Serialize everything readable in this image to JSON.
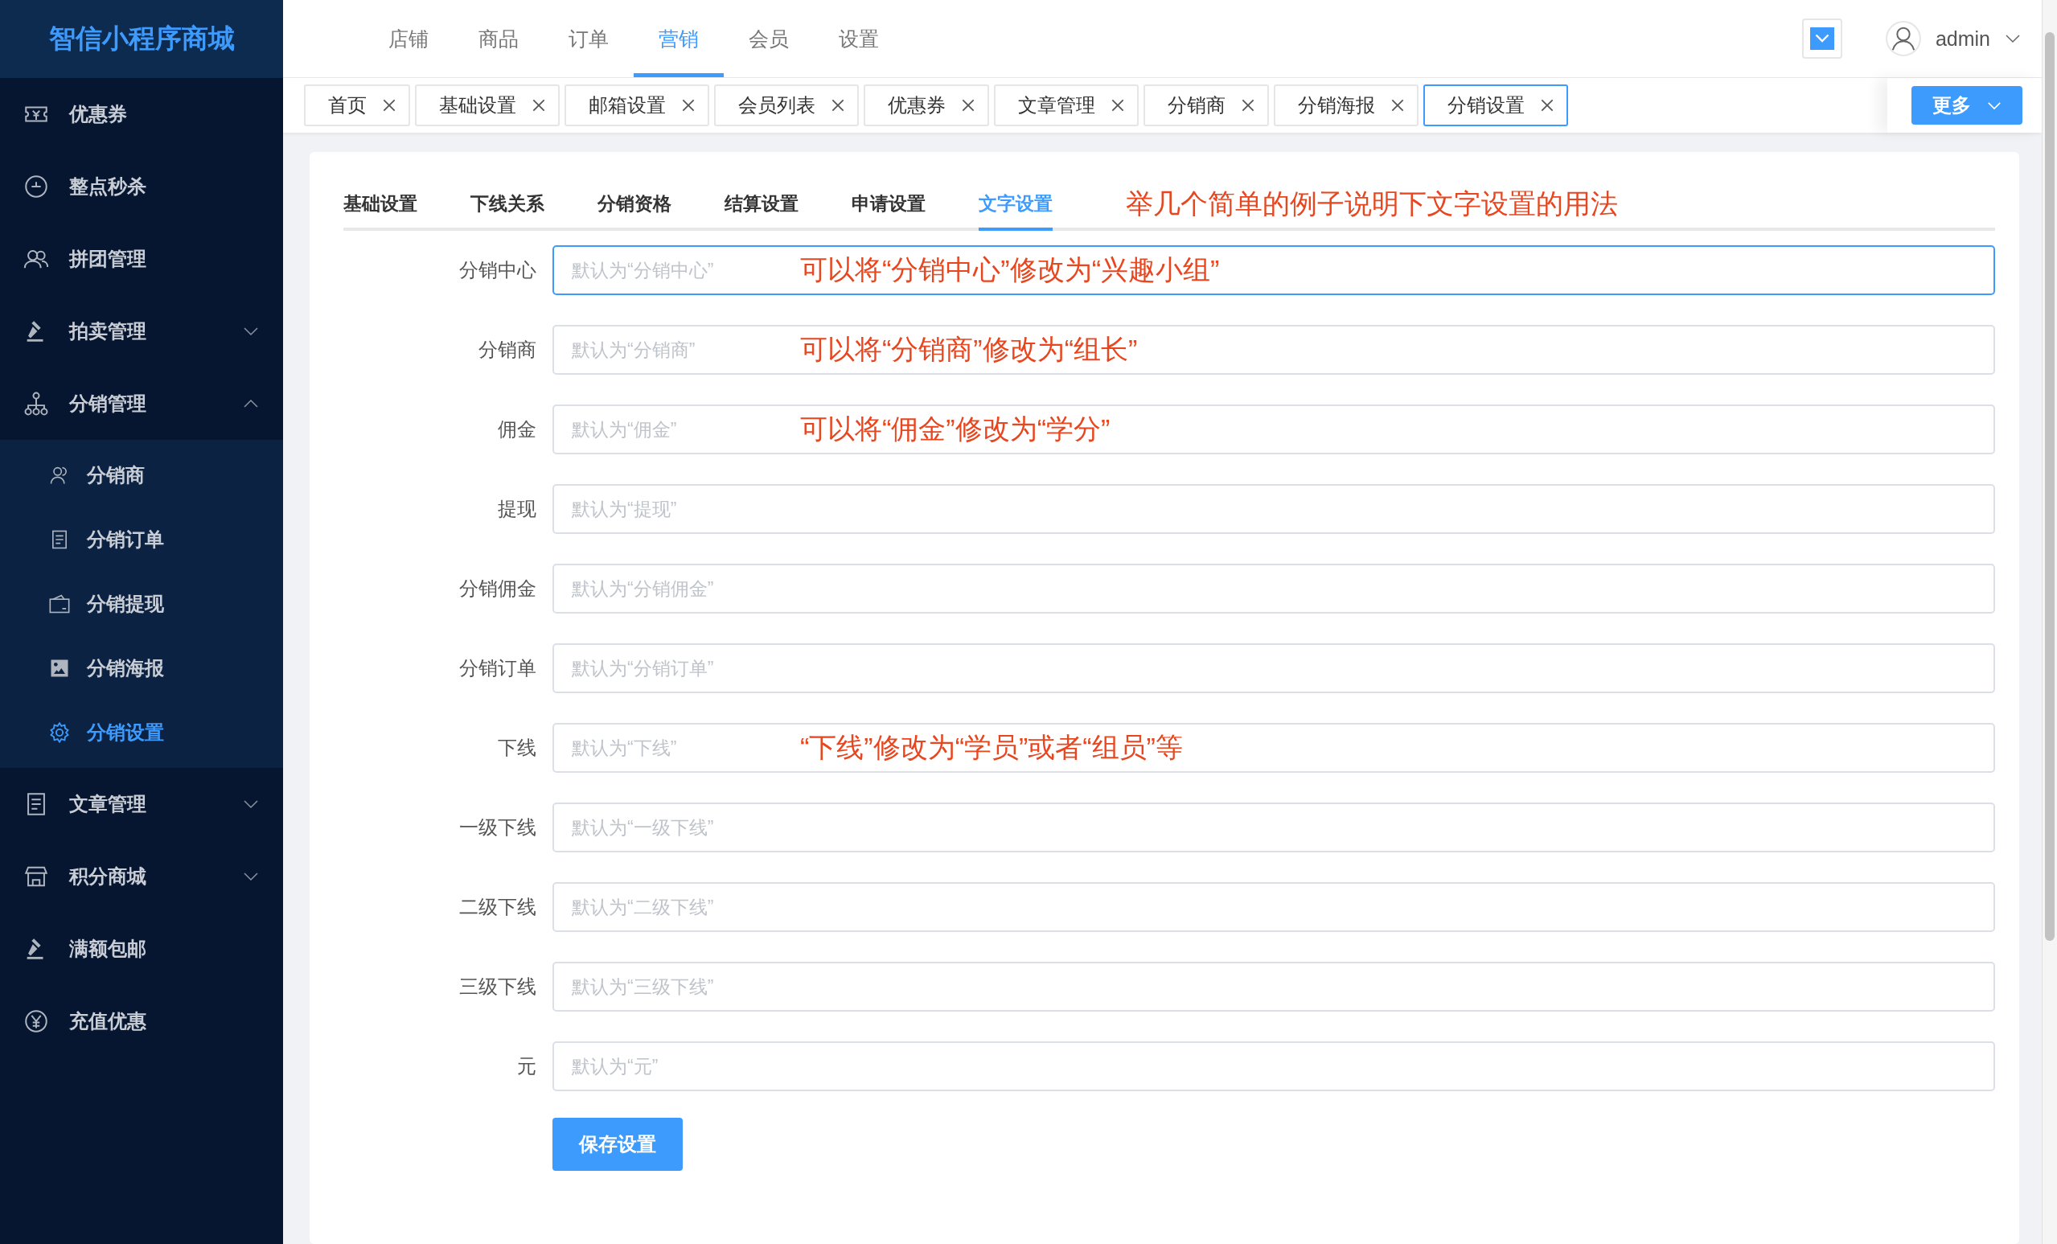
{
  "sidebar": {
    "logo": "智信小程序商城",
    "items": [
      {
        "label": "优惠券"
      },
      {
        "label": "整点秒杀"
      },
      {
        "label": "拼团管理"
      },
      {
        "label": "拍卖管理",
        "expanded": false
      },
      {
        "label": "分销管理",
        "expanded": true,
        "children": [
          {
            "label": "分销商",
            "selected": false
          },
          {
            "label": "分销订单",
            "selected": false
          },
          {
            "label": "分销提现",
            "selected": false
          },
          {
            "label": "分销海报",
            "selected": false
          },
          {
            "label": "分销设置",
            "selected": true
          }
        ]
      },
      {
        "label": "文章管理",
        "expanded": false
      },
      {
        "label": "积分商城",
        "expanded": false
      },
      {
        "label": "满额包邮"
      },
      {
        "label": "充值优惠"
      }
    ]
  },
  "top_nav": [
    {
      "label": "店铺",
      "selected": false
    },
    {
      "label": "商品",
      "selected": false
    },
    {
      "label": "订单",
      "selected": false
    },
    {
      "label": "营销",
      "selected": true
    },
    {
      "label": "会员",
      "selected": false
    },
    {
      "label": "设置",
      "selected": false
    }
  ],
  "user": {
    "name": "admin"
  },
  "open_tabs": [
    {
      "label": "首页",
      "selected": false
    },
    {
      "label": "基础设置",
      "selected": false
    },
    {
      "label": "邮箱设置",
      "selected": false
    },
    {
      "label": "会员列表",
      "selected": false
    },
    {
      "label": "优惠券",
      "selected": false
    },
    {
      "label": "文章管理",
      "selected": false
    },
    {
      "label": "分销商",
      "selected": false
    },
    {
      "label": "分销海报",
      "selected": false
    },
    {
      "label": "分销设置",
      "selected": true
    }
  ],
  "more_button": "更多",
  "settings_tabs": [
    {
      "label": "基础设置",
      "selected": false
    },
    {
      "label": "下线关系",
      "selected": false
    },
    {
      "label": "分销资格",
      "selected": false
    },
    {
      "label": "结算设置",
      "selected": false
    },
    {
      "label": "申请设置",
      "selected": false
    },
    {
      "label": "文字设置",
      "selected": true
    }
  ],
  "tabs_annotation": "举几个简单的例子说明下文字设置的用法",
  "form": [
    {
      "label": "分销中心",
      "placeholder": "默认为“分销中心”",
      "focused": true,
      "annotation": "可以将“分销中心”修改为“兴趣小组”"
    },
    {
      "label": "分销商",
      "placeholder": "默认为“分销商”",
      "focused": false,
      "annotation": "可以将“分销商”修改为“组长”"
    },
    {
      "label": "佣金",
      "placeholder": "默认为“佣金”",
      "focused": false,
      "annotation": "可以将“佣金”修改为“学分”"
    },
    {
      "label": "提现",
      "placeholder": "默认为“提现”",
      "focused": false
    },
    {
      "label": "分销佣金",
      "placeholder": "默认为“分销佣金”",
      "focused": false
    },
    {
      "label": "分销订单",
      "placeholder": "默认为“分销订单”",
      "focused": false
    },
    {
      "label": "下线",
      "placeholder": "默认为“下线”",
      "focused": false,
      "annotation": "“下线”修改为“学员”或者“组员”等"
    },
    {
      "label": "一级下线",
      "placeholder": "默认为“一级下线”",
      "focused": false
    },
    {
      "label": "二级下线",
      "placeholder": "默认为“二级下线”",
      "focused": false
    },
    {
      "label": "三级下线",
      "placeholder": "默认为“三级下线”",
      "focused": false
    },
    {
      "label": "元",
      "placeholder": "默认为“元”",
      "focused": false
    }
  ],
  "save_button": "保存设置"
}
